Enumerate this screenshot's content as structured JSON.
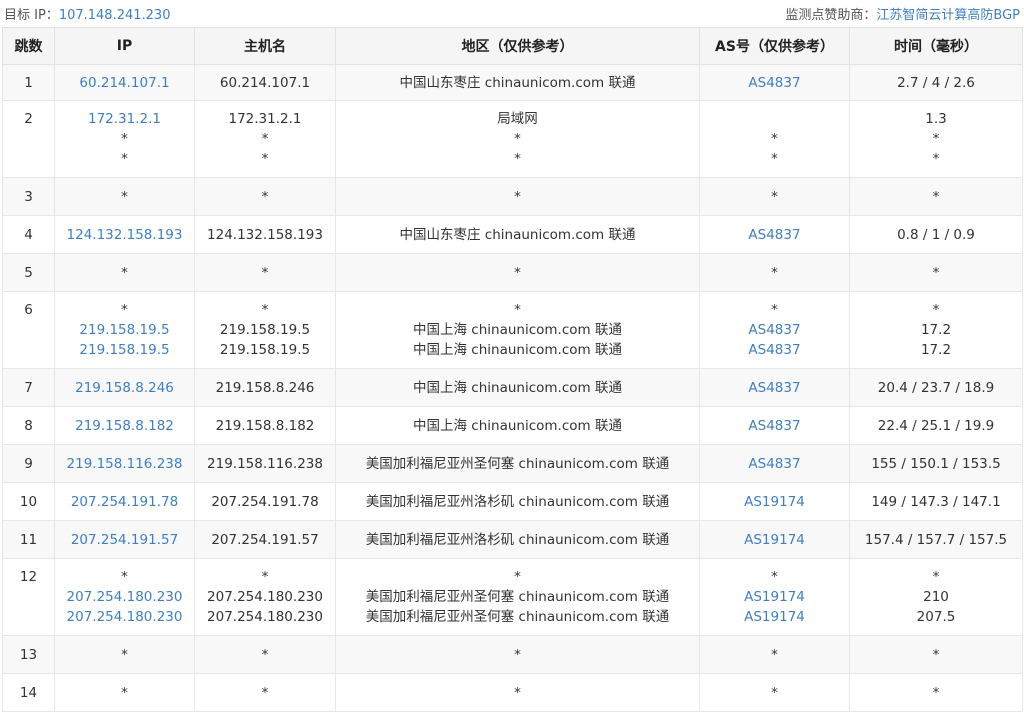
{
  "header": {
    "target_label": "目标 IP：",
    "target_ip": "107.148.241.230",
    "sponsor_label": "监测点赞助商：",
    "sponsor_name": "江苏智简云计算高防BGP"
  },
  "table": {
    "columns": [
      "跳数",
      "IP",
      "主机名",
      "地区（仅供参考）",
      "AS号（仅供参考）",
      "时间（毫秒）"
    ],
    "rows": [
      {
        "hop": "1",
        "ip": [
          "60.214.107.1"
        ],
        "host": [
          "60.214.107.1"
        ],
        "region": [
          "中国山东枣庄 chinaunicom.com 联通"
        ],
        "as": [
          "AS4837"
        ],
        "time": [
          "2.7 / 4 / 2.6"
        ]
      },
      {
        "hop": "2",
        "ip": [
          "172.31.2.1",
          "*",
          "*"
        ],
        "host": [
          "172.31.2.1",
          "*",
          "*"
        ],
        "region": [
          "局域网",
          "*",
          "*"
        ],
        "as": [
          "",
          "*",
          "*"
        ],
        "time": [
          "1.3",
          "*",
          "*"
        ]
      },
      {
        "hop": "3",
        "ip": [
          "*"
        ],
        "host": [
          "*"
        ],
        "region": [
          "*"
        ],
        "as": [
          "*"
        ],
        "time": [
          "*"
        ]
      },
      {
        "hop": "4",
        "ip": [
          "124.132.158.193"
        ],
        "host": [
          "124.132.158.193"
        ],
        "region": [
          "中国山东枣庄 chinaunicom.com 联通"
        ],
        "as": [
          "AS4837"
        ],
        "time": [
          "0.8 / 1 / 0.9"
        ]
      },
      {
        "hop": "5",
        "ip": [
          "*"
        ],
        "host": [
          "*"
        ],
        "region": [
          "*"
        ],
        "as": [
          "*"
        ],
        "time": [
          "*"
        ]
      },
      {
        "hop": "6",
        "ip": [
          "*",
          "219.158.19.5",
          "219.158.19.5"
        ],
        "host": [
          "*",
          "219.158.19.5",
          "219.158.19.5"
        ],
        "region": [
          "*",
          "中国上海 chinaunicom.com 联通",
          "中国上海 chinaunicom.com 联通"
        ],
        "as": [
          "*",
          "AS4837",
          "AS4837"
        ],
        "time": [
          "*",
          "17.2",
          "17.2"
        ]
      },
      {
        "hop": "7",
        "ip": [
          "219.158.8.246"
        ],
        "host": [
          "219.158.8.246"
        ],
        "region": [
          "中国上海 chinaunicom.com 联通"
        ],
        "as": [
          "AS4837"
        ],
        "time": [
          "20.4 / 23.7 / 18.9"
        ]
      },
      {
        "hop": "8",
        "ip": [
          "219.158.8.182"
        ],
        "host": [
          "219.158.8.182"
        ],
        "region": [
          "中国上海 chinaunicom.com 联通"
        ],
        "as": [
          "AS4837"
        ],
        "time": [
          "22.4 / 25.1 / 19.9"
        ]
      },
      {
        "hop": "9",
        "ip": [
          "219.158.116.238"
        ],
        "host": [
          "219.158.116.238"
        ],
        "region": [
          "美国加利福尼亚州圣何塞 chinaunicom.com 联通"
        ],
        "as": [
          "AS4837"
        ],
        "time": [
          "155 / 150.1 / 153.5"
        ]
      },
      {
        "hop": "10",
        "ip": [
          "207.254.191.78"
        ],
        "host": [
          "207.254.191.78"
        ],
        "region": [
          "美国加利福尼亚州洛杉矶 chinaunicom.com 联通"
        ],
        "as": [
          "AS19174"
        ],
        "time": [
          "149 / 147.3 / 147.1"
        ]
      },
      {
        "hop": "11",
        "ip": [
          "207.254.191.57"
        ],
        "host": [
          "207.254.191.57"
        ],
        "region": [
          "美国加利福尼亚州洛杉矶 chinaunicom.com 联通"
        ],
        "as": [
          "AS19174"
        ],
        "time": [
          "157.4 / 157.7 / 157.5"
        ]
      },
      {
        "hop": "12",
        "ip": [
          "*",
          "207.254.180.230",
          "207.254.180.230"
        ],
        "host": [
          "*",
          "207.254.180.230",
          "207.254.180.230"
        ],
        "region": [
          "*",
          "美国加利福尼亚州圣何塞 chinaunicom.com 联通",
          "美国加利福尼亚州圣何塞 chinaunicom.com 联通"
        ],
        "as": [
          "*",
          "AS19174",
          "AS19174"
        ],
        "time": [
          "*",
          "210",
          "207.5"
        ]
      },
      {
        "hop": "13",
        "ip": [
          "*"
        ],
        "host": [
          "*"
        ],
        "region": [
          "*"
        ],
        "as": [
          "*"
        ],
        "time": [
          "*"
        ]
      },
      {
        "hop": "14",
        "ip": [
          "*"
        ],
        "host": [
          "*"
        ],
        "region": [
          "*"
        ],
        "as": [
          "*"
        ],
        "time": [
          "*"
        ]
      }
    ]
  },
  "colors": {
    "link": "#3e7fc2",
    "header_bg": "#f5f5f5",
    "row_alt_bg": "#f8f8f8"
  }
}
